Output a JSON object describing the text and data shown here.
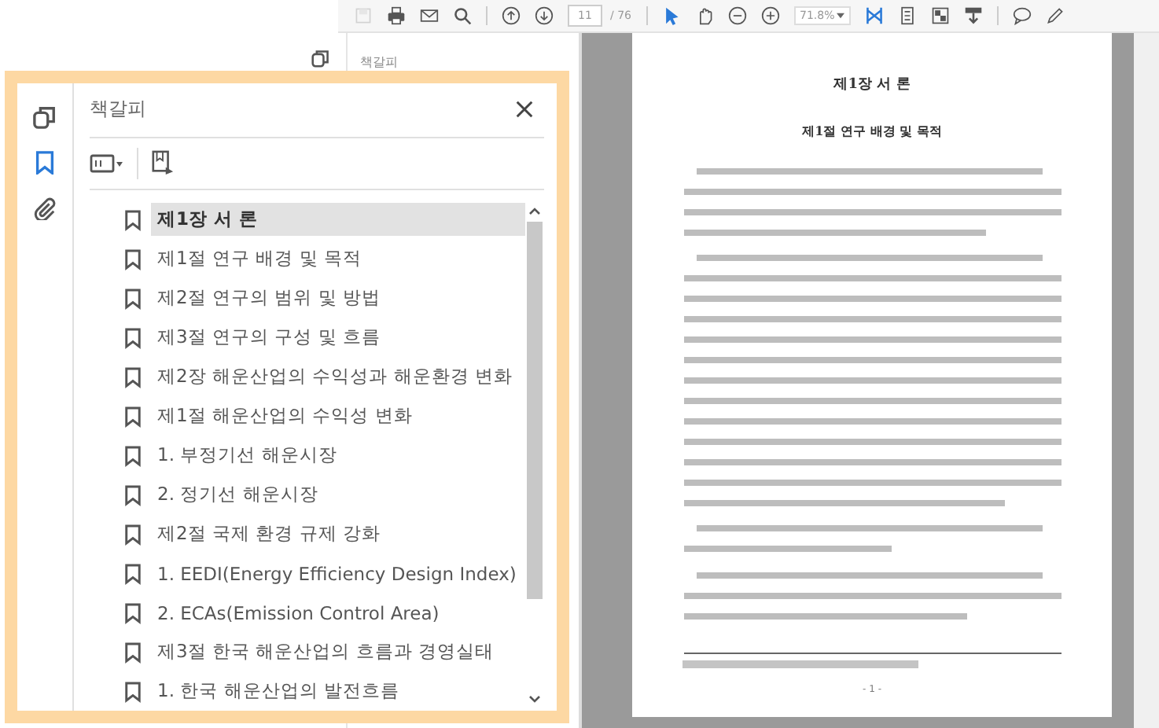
{
  "toolbar": {
    "page_field": {
      "value": "11"
    },
    "page_total": "/ 76",
    "zoom_field": {
      "value": "71.8%"
    },
    "tools": [
      {
        "kind": "select",
        "selected": true
      },
      {
        "kind": "hand",
        "selected": false
      }
    ]
  },
  "side_panel": {
    "title": "책갈피"
  },
  "callout": {
    "title": "책갈피",
    "rail": [
      {
        "kind": "pages",
        "selected": false
      },
      {
        "kind": "bookmarks",
        "selected": true
      },
      {
        "kind": "attachments",
        "selected": false
      }
    ],
    "bookmarks": [
      {
        "label": "제1장 서 론",
        "selected": true
      },
      {
        "label": "제1절 연구 배경 및 목적",
        "selected": false
      },
      {
        "label": "제2절 연구의 범위 및 방법",
        "selected": false
      },
      {
        "label": "제3절 연구의 구성 및 흐름",
        "selected": false
      },
      {
        "label": "제2장 해운산업의 수익성과 해운환경 변화",
        "selected": false
      },
      {
        "label": "제1절 해운산업의 수익성 변화",
        "selected": false
      },
      {
        "label": "1. 부정기선 해운시장",
        "selected": false
      },
      {
        "label": "2. 정기선 해운시장",
        "selected": false
      },
      {
        "label": "제2절 국제 환경 규제 강화",
        "selected": false
      },
      {
        "label": "1. EEDI(Energy Efficiency Design Index)",
        "selected": false
      },
      {
        "label": "2. ECAs(Emission Control Area)",
        "selected": false
      },
      {
        "label": "제3절 한국 해운산업의 흐름과 경영실태",
        "selected": false
      },
      {
        "label": "1. 한국 해운산업의 발전흐름",
        "selected": false
      }
    ]
  },
  "document": {
    "chapter_title": "제1장 서 론",
    "section_title": "제1절 연구 배경 및 목적",
    "page_number": "- 1 -"
  }
}
